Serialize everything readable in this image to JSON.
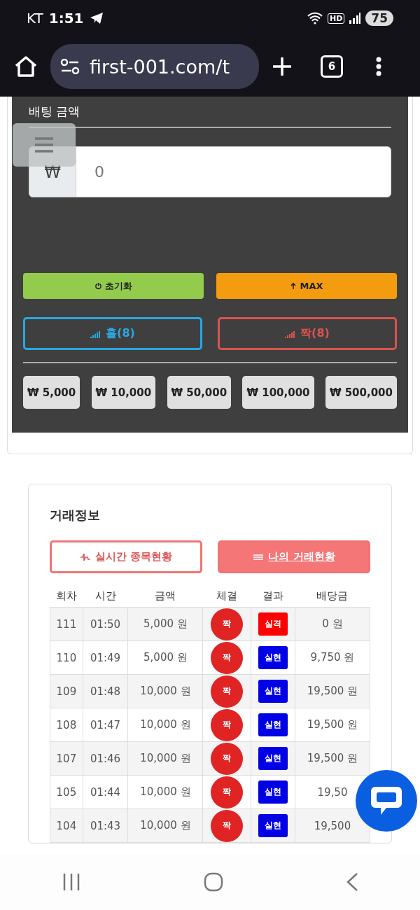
{
  "status_bar": {
    "carrier": "KT",
    "time": "1:51",
    "hd": "HD",
    "battery": "75"
  },
  "browser": {
    "url": "first-001.com/t",
    "tab_count": "6"
  },
  "bet": {
    "label": "배팅 금액",
    "currency": "₩",
    "amount_placeholder": "0",
    "actions": [
      {
        "kind": "reset",
        "label": "초기화"
      },
      {
        "kind": "max",
        "label": "MAX"
      }
    ],
    "picks": [
      {
        "label": "홀(8)",
        "color": "#29a8e0"
      },
      {
        "label": "짝(8)",
        "color": "#d9534f"
      }
    ],
    "chips": [
      "₩ 5,000",
      "₩ 10,000",
      "₩ 50,000",
      "₩ 100,000",
      "₩ 500,000"
    ]
  },
  "trade": {
    "title": "거래정보",
    "tabs": [
      {
        "label": "실시간 종목현황",
        "selected": false
      },
      {
        "label": "나의 거래현황",
        "selected": true
      }
    ],
    "columns": [
      "회차",
      "시간",
      "금액",
      "체결",
      "결과",
      "배당금"
    ],
    "rows": [
      {
        "round": "111",
        "time": "01:50",
        "amount": "5,000 원",
        "pick": {
          "label": "짝",
          "color": "#e02424"
        },
        "result": {
          "label": "실격",
          "color": "#ff0000"
        },
        "payout": "0 원"
      },
      {
        "round": "110",
        "time": "01:49",
        "amount": "5,000 원",
        "pick": {
          "label": "짝",
          "color": "#e02424"
        },
        "result": {
          "label": "실현",
          "color": "#0000e6"
        },
        "payout": "9,750 원"
      },
      {
        "round": "109",
        "time": "01:48",
        "amount": "10,000 원",
        "pick": {
          "label": "짝",
          "color": "#e02424"
        },
        "result": {
          "label": "실현",
          "color": "#0000e6"
        },
        "payout": "19,500 원"
      },
      {
        "round": "108",
        "time": "01:47",
        "amount": "10,000 원",
        "pick": {
          "label": "짝",
          "color": "#e02424"
        },
        "result": {
          "label": "실현",
          "color": "#0000e6"
        },
        "payout": "19,500 원"
      },
      {
        "round": "107",
        "time": "01:46",
        "amount": "10,000 원",
        "pick": {
          "label": "짝",
          "color": "#e02424"
        },
        "result": {
          "label": "실현",
          "color": "#0000e6"
        },
        "payout": "19,500 원"
      },
      {
        "round": "105",
        "time": "01:44",
        "amount": "10,000 원",
        "pick": {
          "label": "짝",
          "color": "#e02424"
        },
        "result": {
          "label": "실현",
          "color": "#0000e6"
        },
        "payout": "19,50"
      },
      {
        "round": "104",
        "time": "01:43",
        "amount": "10,000 원",
        "pick": {
          "label": "짝",
          "color": "#e02424"
        },
        "result": {
          "label": "실현",
          "color": "#0000e6"
        },
        "payout": "19,500"
      }
    ]
  }
}
